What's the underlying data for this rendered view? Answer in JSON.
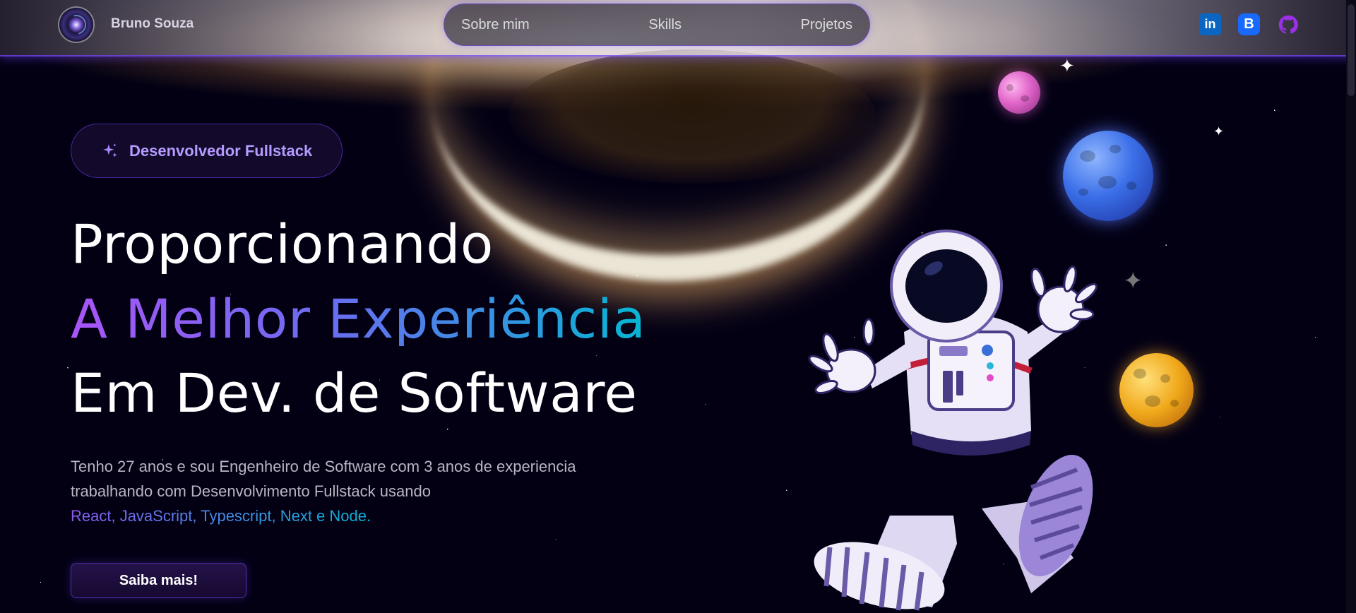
{
  "header": {
    "brand": "Bruno Souza",
    "nav": [
      "Sobre mim",
      "Skills",
      "Projetos"
    ],
    "socials": [
      "linkedin-icon",
      "behance-icon",
      "github-icon"
    ]
  },
  "hero": {
    "badge": "Desenvolvedor Fullstack",
    "title_line1": "Proporcionando",
    "title_line2": "A Melhor Experiência",
    "title_line3": "Em Dev. de Software",
    "description": "Tenho 27 anos e sou Engenheiro de Software com 3 anos de experiencia trabalhando com Desenvolvimento Fullstack usando",
    "description_highlight": "React, JavaScript, Typescript, Next e Node.",
    "cta": "Saiba mais!"
  },
  "colors": {
    "accent": "#7042f8",
    "gradient_start": "#a855f7",
    "gradient_end": "#06b6d4",
    "background": "#030014"
  }
}
